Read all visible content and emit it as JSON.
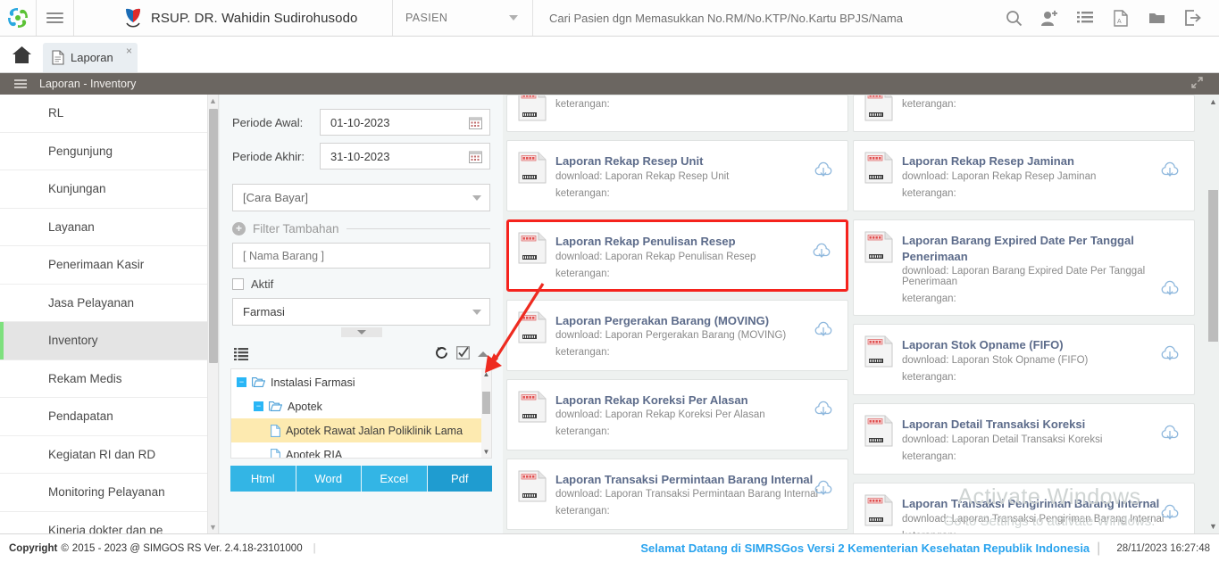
{
  "topbar": {
    "logo_icon": "simgos-logo-icon",
    "menu_icon": "hamburger-icon",
    "hospital_icon": "hospital-crest-icon",
    "hospital_name": "RSUP. DR. Wahidin Sudirohusodo",
    "context_select": "PASIEN",
    "search_placeholder": "Cari Pasien dgn Memasukkan No.RM/No.KTP/No.Kartu BPJS/Nama",
    "icons": [
      {
        "name": "search-icon",
        "glyph": "⌕"
      },
      {
        "name": "add-user-icon",
        "glyph": "👤"
      },
      {
        "name": "list-icon",
        "glyph": "☰"
      },
      {
        "name": "pdf-icon",
        "glyph": "🗎"
      },
      {
        "name": "folder-icon",
        "glyph": "📁"
      },
      {
        "name": "logout-icon",
        "glyph": "↪"
      }
    ]
  },
  "tabs": {
    "home_icon": "home-icon",
    "items": [
      {
        "label": "Laporan",
        "icon": "document-icon",
        "close": "×",
        "active": true
      }
    ]
  },
  "breadcrumb": {
    "menu_icon": "hamburger-icon",
    "title": "Laporan - Inventory",
    "expand_icon": "expand-arrows-icon"
  },
  "sidebar": {
    "items": [
      {
        "label": "RL",
        "active": false
      },
      {
        "label": "Pengunjung",
        "active": false
      },
      {
        "label": "Kunjungan",
        "active": false
      },
      {
        "label": "Layanan",
        "active": false
      },
      {
        "label": "Penerimaan Kasir",
        "active": false
      },
      {
        "label": "Jasa Pelayanan",
        "active": false
      },
      {
        "label": "Inventory",
        "active": true
      },
      {
        "label": "Rekam Medis",
        "active": false
      },
      {
        "label": "Pendapatan",
        "active": false
      },
      {
        "label": "Kegiatan RI dan RD",
        "active": false
      },
      {
        "label": "Monitoring Pelayanan",
        "active": false
      },
      {
        "label": "Kinerja dokter dan pe",
        "active": false
      }
    ]
  },
  "filters": {
    "periode_awal_label": "Periode Awal:",
    "periode_awal_value": "01-10-2023",
    "periode_akhir_label": "Periode Akhir:",
    "periode_akhir_value": "31-10-2023",
    "calendar_icon": "calendar-icon",
    "cara_bayar_value": "[Cara Bayar]",
    "filter_tambahan_label": "Filter Tambahan",
    "plus_icon": "plus-circle-icon",
    "nama_barang_placeholder": "[ Nama Barang ]",
    "aktif_label": "Aktif",
    "aktif_checked": false,
    "unit_value": "Farmasi",
    "collapse_icon": "caret-down-icon",
    "tree_toolbar": {
      "list_icon": "list-bullets-icon",
      "refresh_icon": "history-refresh-icon",
      "checkbox_icon": "checkbox-checked-icon",
      "collapse_icon": "caret-up-icon"
    },
    "tree": [
      {
        "label": "Instalasi Farmasi",
        "level": 1,
        "toggler": "−",
        "type": "folder",
        "selected": false
      },
      {
        "label": "Apotek",
        "level": 2,
        "toggler": "−",
        "type": "folder",
        "selected": false
      },
      {
        "label": "Apotek Rawat Jalan Poliklinik Lama",
        "level": 3,
        "toggler": "",
        "type": "file",
        "selected": true
      },
      {
        "label": "Apotek RIA",
        "level": 3,
        "toggler": "",
        "type": "file",
        "selected": false
      }
    ],
    "export_buttons": [
      {
        "label": "Html",
        "active": false
      },
      {
        "label": "Word",
        "active": false
      },
      {
        "label": "Excel",
        "active": false
      },
      {
        "label": "Pdf",
        "active": true
      }
    ]
  },
  "reports": {
    "download_label_prefix": "download: ",
    "keterangan_label": "keterangan:",
    "report_icon": "laporan-document-icon",
    "download_icon": "cloud-download-icon",
    "left_column": [
      {
        "title": "",
        "sub": "",
        "clipped": true,
        "highlight": false,
        "tall": false
      },
      {
        "title": "Laporan Rekap Resep Unit",
        "sub": "download: Laporan Rekap Resep Unit",
        "ket": "keterangan:",
        "clipped": false,
        "highlight": false,
        "tall": false
      },
      {
        "title": "Laporan Rekap Penulisan Resep",
        "sub": "download: Laporan Rekap Penulisan Resep",
        "ket": "keterangan:",
        "clipped": false,
        "highlight": true,
        "tall": false
      },
      {
        "title": "Laporan Pergerakan Barang (MOVING)",
        "sub": "download: Laporan Pergerakan Barang (MOVING)",
        "ket": "keterangan:",
        "clipped": false,
        "highlight": false,
        "tall": false
      },
      {
        "title": "Laporan Rekap Koreksi Per Alasan",
        "sub": "download: Laporan Rekap Koreksi Per Alasan",
        "ket": "keterangan:",
        "clipped": false,
        "highlight": false,
        "tall": false
      },
      {
        "title": "Laporan Transaksi Permintaan Barang Internal",
        "sub": "download: Laporan Transaksi Permintaan Barang Internal",
        "ket": "keterangan:",
        "clipped": false,
        "highlight": false,
        "tall": false
      }
    ],
    "right_column": [
      {
        "title": "",
        "sub": "",
        "clipped": true,
        "highlight": false,
        "tall": false
      },
      {
        "title": "Laporan Rekap Resep Jaminan",
        "sub": "download: Laporan Rekap Resep Jaminan",
        "ket": "keterangan:",
        "clipped": false,
        "highlight": false,
        "tall": false
      },
      {
        "title": "Laporan Barang Expired Date Per Tanggal Penerimaan",
        "sub": "download: Laporan Barang Expired Date Per Tanggal Penerimaan",
        "ket": "keterangan:",
        "clipped": false,
        "highlight": false,
        "tall": true
      },
      {
        "title": "Laporan Stok Opname (FIFO)",
        "sub": "download: Laporan Stok Opname (FIFO)",
        "ket": "keterangan:",
        "clipped": false,
        "highlight": false,
        "tall": false
      },
      {
        "title": "Laporan Detail Transaksi Koreksi",
        "sub": "download: Laporan Detail Transaksi Koreksi",
        "ket": "keterangan:",
        "clipped": false,
        "highlight": false,
        "tall": false
      },
      {
        "title": "Laporan Transaksi Pengiriman Barang Internal",
        "sub": "download: Laporan Transaksi Pengiriman Barang Internal",
        "ket": "keterangan:",
        "clipped": false,
        "highlight": false,
        "tall": false
      }
    ]
  },
  "watermark": {
    "line1": "Activate Windows",
    "line2": "Go to Settings to activate Windows."
  },
  "footer": {
    "copyright": "Copyright",
    "copyright_symbol": "©",
    "copyright_text": "2015 - 2023 @ SIMGOS RS Ver. 2.4.18-23101000",
    "welcome": "Selamat Datang di SIMRSGos Versi 2 Kementerian Kesehatan Republik Indonesia",
    "timestamp": "28/11/2023 16:27:48"
  },
  "colors": {
    "accent_blue": "#33b5e5",
    "highlight_red": "#f5231d",
    "active_green": "#7ee07e",
    "tree_selected": "#fdeab0",
    "breadcrumb_bg": "#6b6661"
  }
}
